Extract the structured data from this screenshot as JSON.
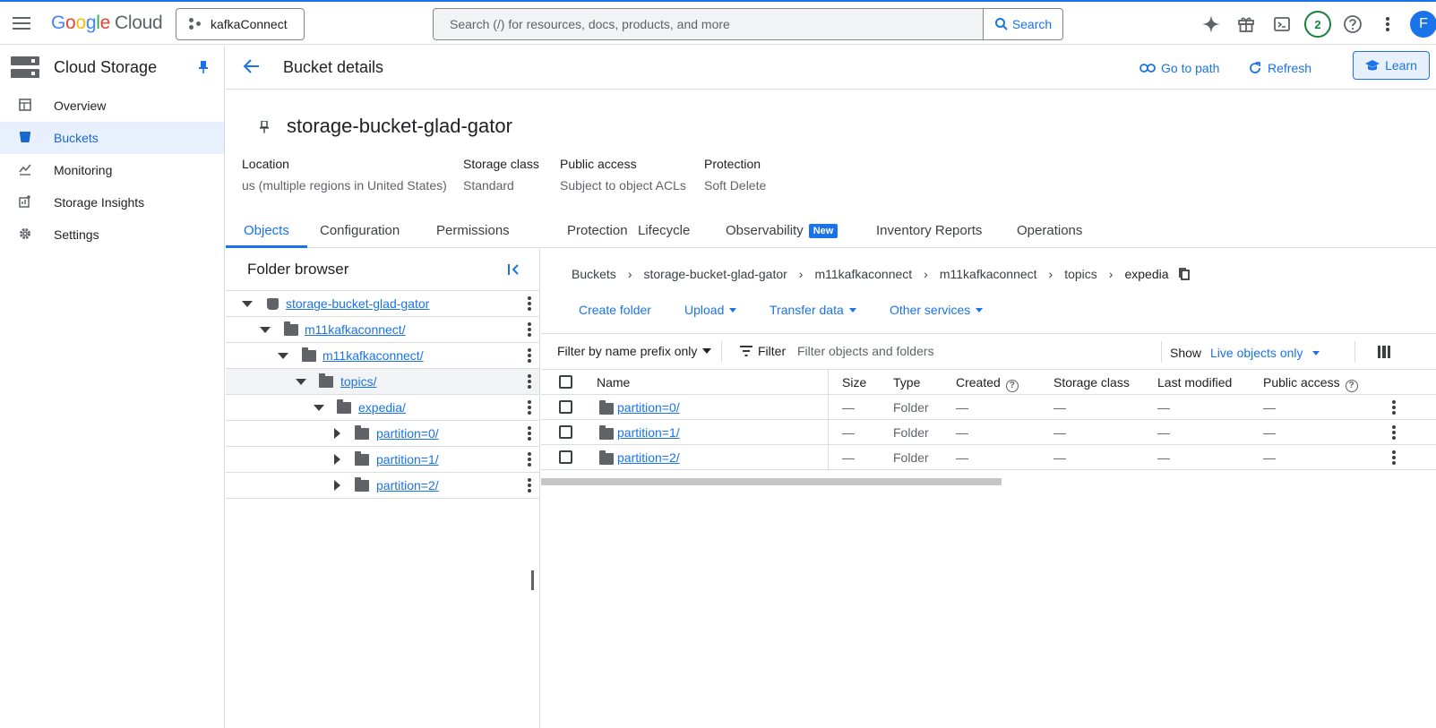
{
  "topbar": {
    "logo_google": [
      "G",
      "o",
      "o",
      "g",
      "l",
      "e"
    ],
    "logo_cloud": "Cloud",
    "project": "kafkaConnect",
    "search_placeholder": "Search (/) for resources, docs, products, and more",
    "search_button": "Search",
    "notifications_count": "2",
    "avatar_letter": "F"
  },
  "sidebar": {
    "product_name": "Cloud Storage",
    "items": [
      {
        "label": "Overview",
        "icon": "dashboard-icon"
      },
      {
        "label": "Buckets",
        "icon": "bucket-icon",
        "active": true
      },
      {
        "label": "Monitoring",
        "icon": "monitoring-icon"
      },
      {
        "label": "Storage Insights",
        "icon": "insights-icon"
      },
      {
        "label": "Settings",
        "icon": "gear-icon"
      }
    ]
  },
  "header": {
    "title": "Bucket details",
    "go_to_path": "Go to path",
    "refresh": "Refresh",
    "learn": "Learn"
  },
  "bucket": {
    "name": "storage-bucket-glad-gator",
    "meta": [
      {
        "key": "Location",
        "value": "us (multiple regions in United States)"
      },
      {
        "key": "Storage class",
        "value": "Standard"
      },
      {
        "key": "Public access",
        "value": "Subject to object ACLs"
      },
      {
        "key": "Protection",
        "value": "Soft Delete"
      }
    ]
  },
  "tabs": [
    {
      "label": "Objects",
      "active": true
    },
    {
      "label": "Configuration"
    },
    {
      "label": "Permissions"
    },
    {
      "label": "Protection"
    },
    {
      "label": "Lifecycle"
    },
    {
      "label": "Observability",
      "badge": "New"
    },
    {
      "label": "Inventory Reports"
    },
    {
      "label": "Operations"
    }
  ],
  "folder_browser": {
    "title": "Folder browser",
    "tree": [
      {
        "label": "storage-bucket-glad-gator",
        "kind": "bucket",
        "expanded": true
      },
      {
        "label": "m11kafkaconnect/",
        "kind": "folder",
        "expanded": true
      },
      {
        "label": "m11kafkaconnect/",
        "kind": "folder",
        "expanded": true
      },
      {
        "label": "topics/",
        "kind": "folder",
        "expanded": true,
        "selected": true
      },
      {
        "label": "expedia/",
        "kind": "folder",
        "expanded": true
      },
      {
        "label": "partition=0/",
        "kind": "folder",
        "expanded": false
      },
      {
        "label": "partition=1/",
        "kind": "folder",
        "expanded": false
      },
      {
        "label": "partition=2/",
        "kind": "folder",
        "expanded": false
      }
    ]
  },
  "breadcrumb": [
    "Buckets",
    "storage-bucket-glad-gator",
    "m11kafkaconnect",
    "m11kafkaconnect",
    "topics",
    "expedia"
  ],
  "toolbar": {
    "create_folder": "Create folder",
    "upload": "Upload",
    "transfer_data": "Transfer data",
    "other_services": "Other services"
  },
  "filter": {
    "prefix_select": "Filter by name prefix only",
    "filter_label": "Filter",
    "placeholder": "Filter objects and folders",
    "show_label": "Show",
    "show_value": "Live objects only"
  },
  "table": {
    "columns": [
      "Name",
      "Size",
      "Type",
      "Created",
      "Storage class",
      "Last modified",
      "Public access"
    ],
    "rows": [
      {
        "name": "partition=0/",
        "size": "—",
        "type": "Folder",
        "created": "—",
        "storage_class": "—",
        "last_modified": "—",
        "public_access": "—"
      },
      {
        "name": "partition=1/",
        "size": "—",
        "type": "Folder",
        "created": "—",
        "storage_class": "—",
        "last_modified": "—",
        "public_access": "—"
      },
      {
        "name": "partition=2/",
        "size": "—",
        "type": "Folder",
        "created": "—",
        "storage_class": "—",
        "last_modified": "—",
        "public_access": "—"
      }
    ]
  },
  "colors": {
    "accent": "#1a73e8",
    "active_bg": "#e8f0fe",
    "border": "#dadce0"
  }
}
